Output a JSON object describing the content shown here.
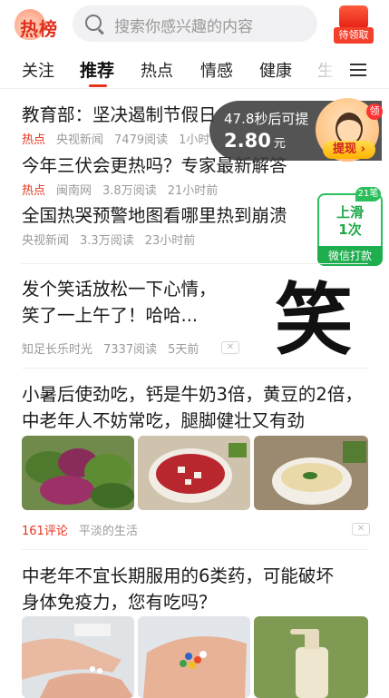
{
  "header": {
    "logo_text": "热榜",
    "search_placeholder": "搜索你感兴趣的内容",
    "gift_label": "待领取"
  },
  "tabs": [
    "关注",
    "推荐",
    "热点",
    "情感",
    "健康",
    "生"
  ],
  "active_tab": "推荐",
  "hot_list": [
    {
      "title": "教育部：坚决遏制节假日",
      "tag": "热点",
      "source": "央视新闻",
      "reads": "7479阅读",
      "time": "1小时"
    },
    {
      "title": "今年三伏会更热吗？专家最新解答",
      "tag": "热点",
      "source": "闽南网",
      "reads": "3.8万阅读",
      "time": "21小时前"
    },
    {
      "title": "全国热哭预警地图看哪里热到崩溃",
      "tag": "",
      "source": "央视新闻",
      "reads": "3.3万阅读",
      "time": "23小时前"
    }
  ],
  "reward_timer": {
    "countdown_text": "47.8秒后可提",
    "amount": "2.80",
    "unit": "元",
    "withdraw_label": "提现",
    "badge": "领"
  },
  "slide_card": {
    "line1": "上滑",
    "line2": "1次",
    "footer": "微信打款",
    "badge": "21笔"
  },
  "articles": [
    {
      "title_lines": [
        "发个笑话放松一下心情，",
        "笑了一上午了！哈哈..."
      ],
      "source": "知足长乐时光",
      "reads": "7337阅读",
      "time": "5天前",
      "thumb_char": "笑"
    },
    {
      "title_lines": [
        "小暑后使劲吃，钙是牛奶3倍，黄豆的2倍，",
        "中老年人不妨常吃，腿脚健壮又有劲"
      ],
      "comments": "161评论",
      "source": "平淡的生活"
    },
    {
      "title_lines": [
        "中老年不宜长期服用的6类药，可能破坏",
        "身体免疫力，您有吃吗？"
      ]
    }
  ],
  "colors": {
    "accent": "#e8321e",
    "green": "#1fae4e"
  }
}
